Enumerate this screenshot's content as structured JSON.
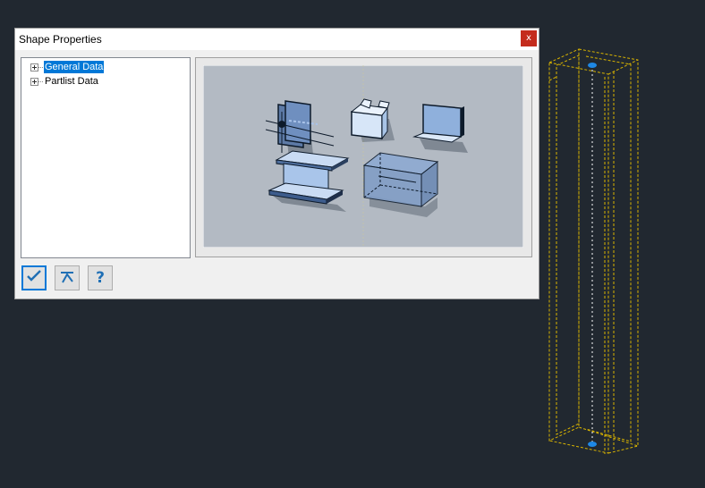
{
  "dialog": {
    "title": "Shape Properties",
    "close_label": "x"
  },
  "tree": {
    "items": [
      {
        "label": "General Data",
        "selected": true
      },
      {
        "label": "Partlist Data",
        "selected": false
      }
    ]
  },
  "toolbar": {
    "ok_icon": "checkmark-icon",
    "pick_icon": "pick-cursor-icon",
    "help_label": "?"
  },
  "colors": {
    "cad_background": "#212830",
    "wireframe": "#d9b400",
    "selection_blue": "#0078d7"
  }
}
